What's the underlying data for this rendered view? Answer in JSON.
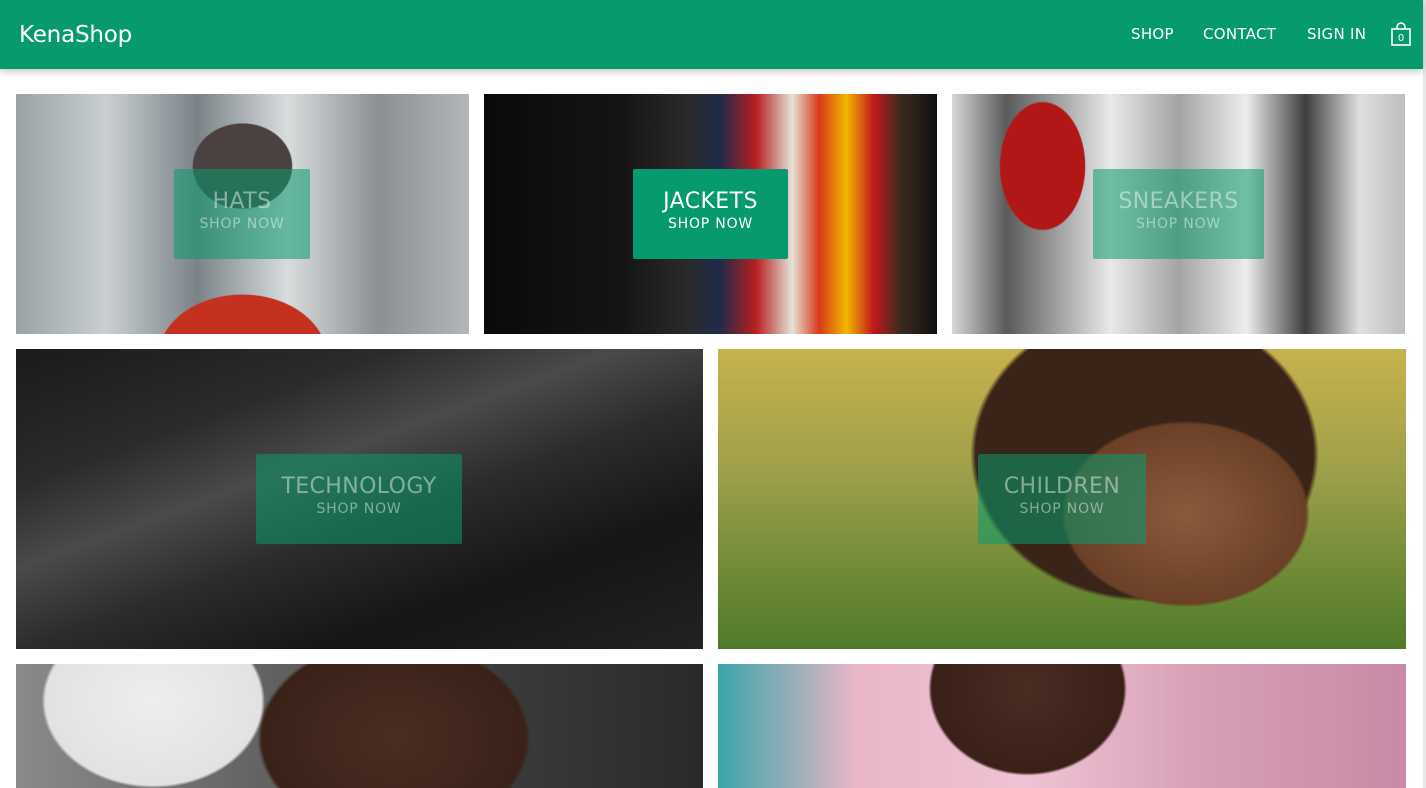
{
  "header": {
    "logo": "KenaShop",
    "nav": {
      "shop": "SHOP",
      "contact": "CONTACT",
      "sign_in": "SIGN IN"
    },
    "cart": {
      "icon": "shopping-bag-icon",
      "count": "0"
    }
  },
  "brand_colors": {
    "primary": "#079a6e",
    "text_on_primary": "#ffffff"
  },
  "categories": [
    {
      "title": "HATS",
      "cta": "SHOP NOW"
    },
    {
      "title": "JACKETS",
      "cta": "SHOP NOW"
    },
    {
      "title": "SNEAKERS",
      "cta": "SHOP NOW"
    },
    {
      "title": "TECHNOLOGY",
      "cta": "SHOP NOW"
    },
    {
      "title": "CHILDREN",
      "cta": "SHOP NOW"
    }
  ]
}
